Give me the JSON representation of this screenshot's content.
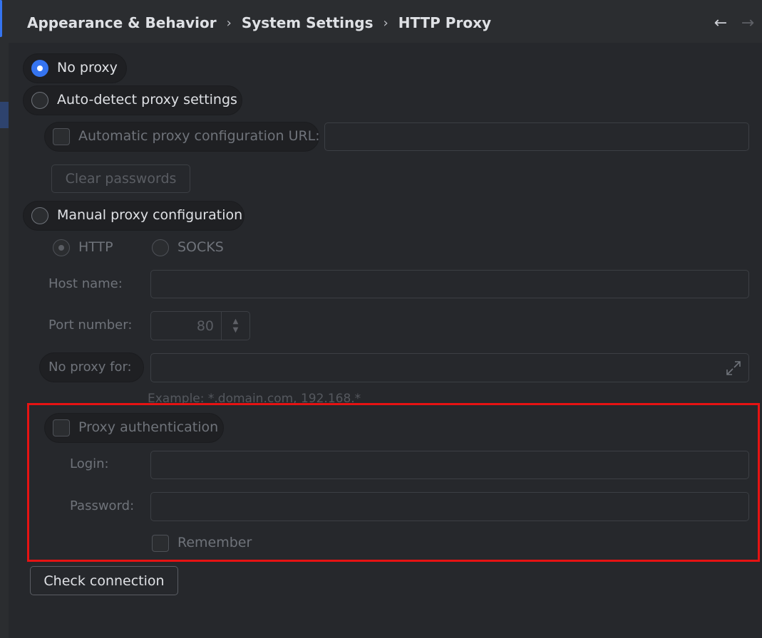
{
  "breadcrumb": {
    "items": [
      "Appearance & Behavior",
      "System Settings",
      "HTTP Proxy"
    ],
    "separator": "›"
  },
  "nav": {
    "back_icon": "←",
    "forward_icon": "→"
  },
  "proxy_mode": {
    "no_proxy": "No proxy",
    "auto_detect": "Auto-detect proxy settings",
    "auto_config_url_label": "Automatic proxy configuration URL:",
    "auto_config_url_value": "",
    "clear_passwords": "Clear passwords",
    "manual": "Manual proxy configuration",
    "selected": "No proxy"
  },
  "manual": {
    "protocol_http": "HTTP",
    "protocol_socks": "SOCKS",
    "host_label": "Host name:",
    "host_value": "",
    "port_label": "Port number:",
    "port_value": "80",
    "no_proxy_label": "No proxy for:",
    "no_proxy_value": "",
    "no_proxy_hint": "Example: *.domain.com, 192.168.*"
  },
  "auth": {
    "checkbox_label": "Proxy authentication",
    "login_label": "Login:",
    "login_value": "",
    "password_label": "Password:",
    "password_value": "",
    "remember_label": "Remember"
  },
  "actions": {
    "check_connection": "Check connection"
  },
  "colors": {
    "accent": "#3574f0",
    "highlight_border": "#e61313"
  }
}
